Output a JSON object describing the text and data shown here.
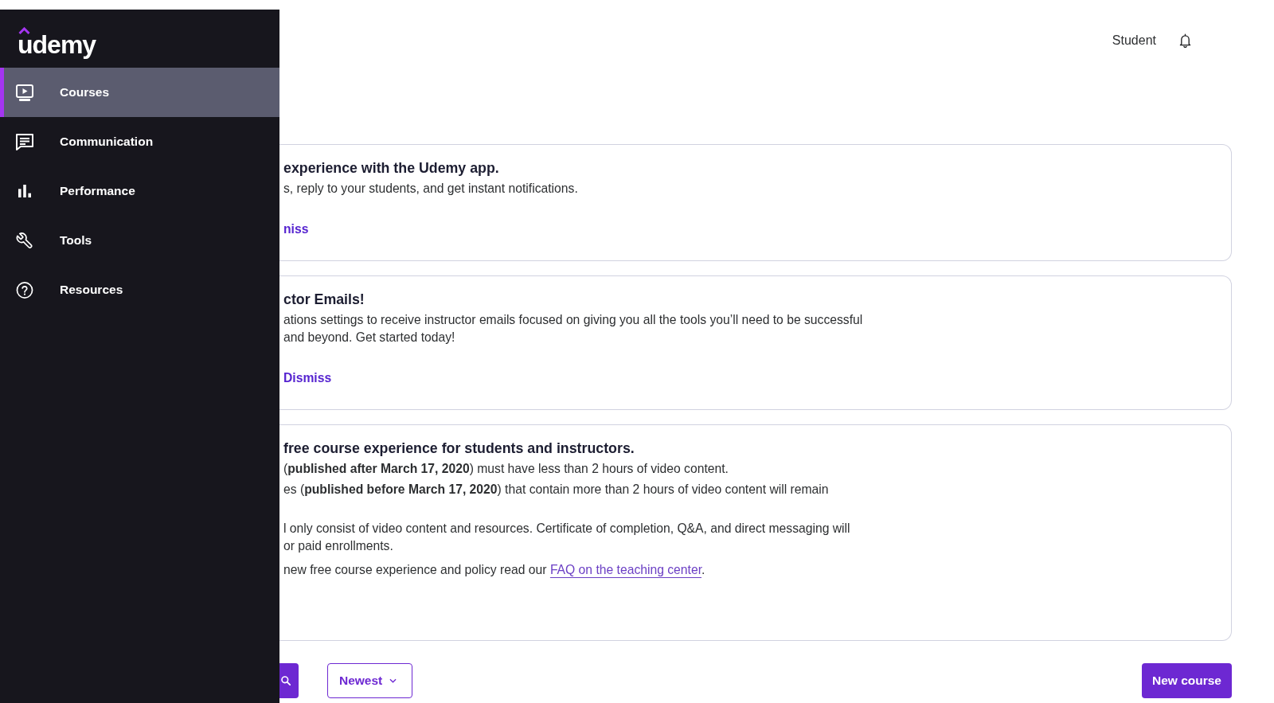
{
  "sidebar": {
    "logo": "udemy",
    "items": [
      {
        "label": "Courses",
        "selected": true
      },
      {
        "label": "Communication",
        "selected": false
      },
      {
        "label": "Performance",
        "selected": false
      },
      {
        "label": "Tools",
        "selected": false
      },
      {
        "label": "Resources",
        "selected": false
      }
    ]
  },
  "header": {
    "view_link": "Student"
  },
  "cards": [
    {
      "title": "experience with the Udemy app.",
      "paragraphs": [
        {
          "lines": [
            "s, reply to your students, and get instant notifications."
          ]
        }
      ],
      "action": "niss"
    },
    {
      "title": "ctor Emails!",
      "paragraphs": [
        {
          "lines": [
            "ations settings to receive instructor emails focused on giving you all the tools you’ll need to be successful",
            "and beyond. Get started today!"
          ]
        }
      ],
      "action": "Dismiss"
    },
    {
      "title": "free course experience for students and instructors.",
      "paragraphs": [
        {
          "lines": [
            "(**published after March 17, 2020**) must have less than 2 hours of video content."
          ]
        },
        {
          "lines": [
            "es (**published before March 17, 2020**) that contain more than 2 hours of video content will remain"
          ]
        },
        {
          "lines": [
            "l only consist of video content and resources. Certificate of completion, Q&A, and direct messaging will",
            "or paid enrollments."
          ]
        },
        {
          "lines": [
            "new free course experience and policy read our"
          ],
          "link": "FAQ on the teaching center",
          "after": "."
        }
      ]
    }
  ],
  "toolbar": {
    "sort": "Newest",
    "new_course": "New course"
  }
}
